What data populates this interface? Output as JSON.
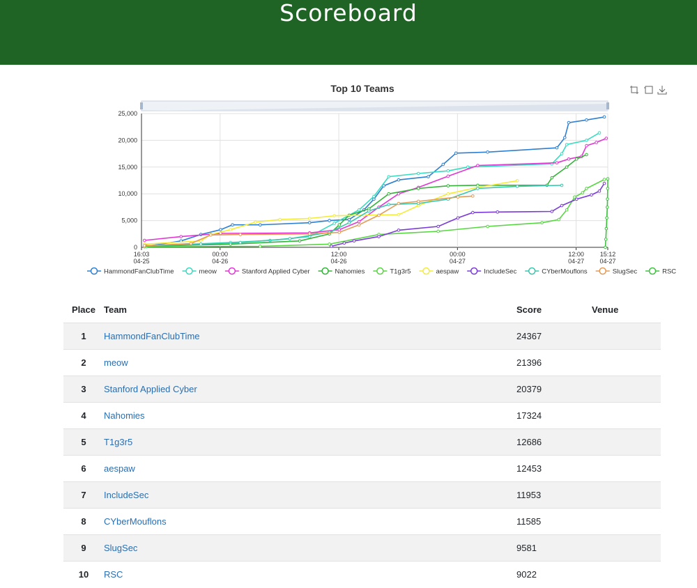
{
  "page": {
    "title": "Scoreboard"
  },
  "chart_data": {
    "type": "line",
    "title": "Top 10 Teams",
    "xlim": [
      "2019-04-25 16:03",
      "2019-04-27 15:12"
    ],
    "ylim": [
      0,
      25000
    ],
    "y_ticks": [
      "0",
      "5,000",
      "10,000",
      "15,000",
      "20,000",
      "25,000"
    ],
    "x_ticks": [
      {
        "time": "16:03",
        "date": "04-25"
      },
      {
        "time": "00:00",
        "date": "04-26"
      },
      {
        "time": "12:00",
        "date": "04-26"
      },
      {
        "time": "00:00",
        "date": "04-27"
      },
      {
        "time": "12:00",
        "date": "04-27"
      },
      {
        "time": "15:12",
        "date": "04-27"
      }
    ],
    "x_tick_hours": [
      0,
      7.95,
      19.95,
      31.95,
      43.95,
      47.15
    ],
    "grid": true,
    "legend_position": "bottom",
    "toolbox": [
      "zoom-icon",
      "zoom-reset-icon",
      "download-icon"
    ],
    "series": [
      {
        "name": "HammondFanClubTime",
        "color": "#2d7fd1",
        "points": [
          [
            0.5,
            200
          ],
          [
            4,
            1200
          ],
          [
            6,
            2400
          ],
          [
            8,
            3300
          ],
          [
            9.2,
            4200
          ],
          [
            12,
            4200
          ],
          [
            17,
            4600
          ],
          [
            19,
            5000
          ],
          [
            21,
            5200
          ],
          [
            22.5,
            7000
          ],
          [
            23.5,
            9000
          ],
          [
            24.5,
            11500
          ],
          [
            26,
            12600
          ],
          [
            29,
            13200
          ],
          [
            30.5,
            15500
          ],
          [
            31.8,
            17600
          ],
          [
            35,
            17800
          ],
          [
            42,
            18600
          ],
          [
            42.8,
            20500
          ],
          [
            43.2,
            23300
          ],
          [
            45,
            23800
          ],
          [
            46.8,
            24367
          ]
        ]
      },
      {
        "name": "meow",
        "color": "#37dcc0",
        "points": [
          [
            0.5,
            100
          ],
          [
            5,
            600
          ],
          [
            9,
            900
          ],
          [
            13,
            1300
          ],
          [
            17,
            2000
          ],
          [
            19.5,
            4500
          ],
          [
            22,
            7000
          ],
          [
            23.5,
            9500
          ],
          [
            25,
            13200
          ],
          [
            28,
            13800
          ],
          [
            31,
            14300
          ],
          [
            33,
            15000
          ],
          [
            41.5,
            15600
          ],
          [
            42.5,
            17500
          ],
          [
            43,
            19200
          ],
          [
            45,
            20000
          ],
          [
            46.3,
            21396
          ]
        ]
      },
      {
        "name": "Stanford Applied Cyber",
        "color": "#e236d4",
        "points": [
          [
            0.3,
            1300
          ],
          [
            4,
            2000
          ],
          [
            8,
            2600
          ],
          [
            17,
            2700
          ],
          [
            20,
            3300
          ],
          [
            22,
            4800
          ],
          [
            24,
            7500
          ],
          [
            26,
            10000
          ],
          [
            28,
            11200
          ],
          [
            31,
            13300
          ],
          [
            34,
            15300
          ],
          [
            42,
            15800
          ],
          [
            43.2,
            16500
          ],
          [
            44.5,
            17000
          ],
          [
            45,
            19000
          ],
          [
            46,
            19600
          ],
          [
            47,
            20379
          ]
        ]
      },
      {
        "name": "Nahomies",
        "color": "#34b339",
        "points": [
          [
            0.3,
            200
          ],
          [
            9,
            600
          ],
          [
            16,
            1200
          ],
          [
            19,
            2500
          ],
          [
            20,
            4200
          ],
          [
            21,
            6000
          ],
          [
            23,
            7200
          ],
          [
            25,
            10000
          ],
          [
            28,
            11000
          ],
          [
            31,
            11500
          ],
          [
            34,
            11600
          ],
          [
            41,
            11600
          ],
          [
            41.5,
            13000
          ],
          [
            43,
            15000
          ],
          [
            44,
            16500
          ],
          [
            45,
            17324
          ]
        ]
      },
      {
        "name": "T1g3r5",
        "color": "#56d640",
        "points": [
          [
            0.3,
            100
          ],
          [
            12,
            200
          ],
          [
            19,
            600
          ],
          [
            24,
            2400
          ],
          [
            30,
            3000
          ],
          [
            35,
            3900
          ],
          [
            40.5,
            4600
          ],
          [
            42.2,
            5200
          ],
          [
            43,
            7000
          ],
          [
            43.8,
            9400
          ],
          [
            44.6,
            10200
          ],
          [
            45,
            11000
          ],
          [
            46.8,
            12686
          ]
        ]
      },
      {
        "name": "aespaw",
        "color": "#f3ec3a",
        "points": [
          [
            0.3,
            600
          ],
          [
            6,
            1200
          ],
          [
            7,
            2400
          ],
          [
            9,
            3300
          ],
          [
            11.5,
            4700
          ],
          [
            14,
            5200
          ],
          [
            17,
            5400
          ],
          [
            19.5,
            5900
          ],
          [
            22.5,
            6000
          ],
          [
            26,
            6100
          ],
          [
            28,
            7800
          ],
          [
            31,
            10000
          ],
          [
            34,
            11200
          ],
          [
            38,
            12453
          ]
        ]
      },
      {
        "name": "IncludeSec",
        "color": "#7a3ad7",
        "points": [
          [
            19.2,
            200
          ],
          [
            20.5,
            800
          ],
          [
            21.5,
            1200
          ],
          [
            24,
            2000
          ],
          [
            26,
            3200
          ],
          [
            30,
            3900
          ],
          [
            32,
            5500
          ],
          [
            33.5,
            6500
          ],
          [
            36,
            6600
          ],
          [
            41.5,
            6700
          ],
          [
            42.5,
            7800
          ],
          [
            44,
            9000
          ],
          [
            45.5,
            9800
          ],
          [
            46.3,
            10500
          ],
          [
            46.8,
            11953
          ]
        ]
      },
      {
        "name": "CYberMouflons",
        "color": "#38c7ac",
        "points": [
          [
            0.3,
            300
          ],
          [
            6,
            600
          ],
          [
            10,
            900
          ],
          [
            15,
            1600
          ],
          [
            19,
            2800
          ],
          [
            21,
            4600
          ],
          [
            23,
            6800
          ],
          [
            25,
            8000
          ],
          [
            28,
            8200
          ],
          [
            31,
            9000
          ],
          [
            34,
            11000
          ],
          [
            38,
            11400
          ],
          [
            42.5,
            11585
          ]
        ]
      },
      {
        "name": "SlugSec",
        "color": "#e39a55",
        "points": [
          [
            0.3,
            300
          ],
          [
            5,
            700
          ],
          [
            7,
            2300
          ],
          [
            10,
            2400
          ],
          [
            17,
            2500
          ],
          [
            20,
            2800
          ],
          [
            22,
            4200
          ],
          [
            24,
            6000
          ],
          [
            26,
            8200
          ],
          [
            28,
            8600
          ],
          [
            32,
            9400
          ],
          [
            33.5,
            9581
          ]
        ]
      },
      {
        "name": "RSC",
        "color": "#3ec23f",
        "points": [
          [
            46.9,
            0
          ],
          [
            46.95,
            1500
          ],
          [
            47,
            3500
          ],
          [
            47.05,
            5500
          ],
          [
            47.1,
            7500
          ],
          [
            47.12,
            9022
          ],
          [
            47.14,
            11000
          ],
          [
            47.15,
            12800
          ]
        ]
      }
    ]
  },
  "table": {
    "headers": {
      "place": "Place",
      "team": "Team",
      "score": "Score",
      "venue": "Venue"
    },
    "rows": [
      {
        "place": "1",
        "team": "HammondFanClubTime",
        "score": "24367",
        "venue": ""
      },
      {
        "place": "2",
        "team": "meow",
        "score": "21396",
        "venue": ""
      },
      {
        "place": "3",
        "team": "Stanford Applied Cyber",
        "score": "20379",
        "venue": ""
      },
      {
        "place": "4",
        "team": "Nahomies",
        "score": "17324",
        "venue": ""
      },
      {
        "place": "5",
        "team": "T1g3r5",
        "score": "12686",
        "venue": ""
      },
      {
        "place": "6",
        "team": "aespaw",
        "score": "12453",
        "venue": ""
      },
      {
        "place": "7",
        "team": "IncludeSec",
        "score": "11953",
        "venue": ""
      },
      {
        "place": "8",
        "team": "CYberMouflons",
        "score": "11585",
        "venue": ""
      },
      {
        "place": "9",
        "team": "SlugSec",
        "score": "9581",
        "venue": ""
      },
      {
        "place": "10",
        "team": "RSC",
        "score": "9022",
        "venue": ""
      }
    ]
  },
  "colors": {
    "header_bg": "#1f6425",
    "link": "#2a6eaf",
    "row_stripe": "#f2f2f2"
  }
}
